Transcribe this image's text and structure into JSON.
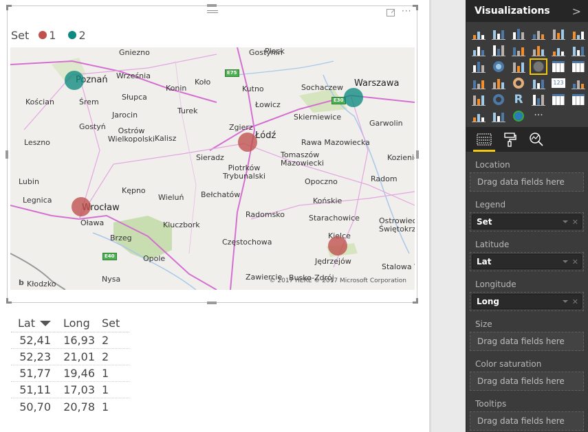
{
  "visual": {
    "legend": {
      "title": "Set",
      "items": [
        {
          "label": "1",
          "color": "#c0504d"
        },
        {
          "label": "2",
          "color": "#0d8a80"
        }
      ]
    },
    "more_label": "···",
    "map": {
      "copyright": "© 2017 HERE   © 2017 Microsoft Corporation",
      "bing_label": "b",
      "cities": [
        {
          "name": "Gniezno"
        },
        {
          "name": "Płock"
        },
        {
          "name": "Poznań"
        },
        {
          "name": "Września"
        },
        {
          "name": "Gostynin"
        },
        {
          "name": "Warszawa"
        },
        {
          "name": "Konin"
        },
        {
          "name": "Koło"
        },
        {
          "name": "Kutno"
        },
        {
          "name": "Sochaczew"
        },
        {
          "name": "Słupca"
        },
        {
          "name": "Kościan"
        },
        {
          "name": "Śrem"
        },
        {
          "name": "Łowicz"
        },
        {
          "name": "Turek"
        },
        {
          "name": "Jarocin"
        },
        {
          "name": "Skierniewice"
        },
        {
          "name": "Garwolin"
        },
        {
          "name": "Gostyń"
        },
        {
          "name": "Zgierz"
        },
        {
          "name": "Łódź"
        },
        {
          "name": "Kalisz"
        },
        {
          "name": "Leszno"
        },
        {
          "name": "Ostrów Wielkopolski"
        },
        {
          "name": "Rawa Mazowiecka"
        },
        {
          "name": "Sieradz"
        },
        {
          "name": "Tomaszów Mazowiecki"
        },
        {
          "name": "Kozienice"
        },
        {
          "name": "Piotrków Trybunalski"
        },
        {
          "name": "Lubin"
        },
        {
          "name": "Opoczno"
        },
        {
          "name": "Radom"
        },
        {
          "name": "Kępno"
        },
        {
          "name": "Legnica"
        },
        {
          "name": "Wieluń"
        },
        {
          "name": "Bełchatów"
        },
        {
          "name": "Końskie"
        },
        {
          "name": "Wrocław"
        },
        {
          "name": "Radomsko"
        },
        {
          "name": "Starachowice"
        },
        {
          "name": "Ostrowiec Świętokrzyski"
        },
        {
          "name": "Oława"
        },
        {
          "name": "Kluczbork"
        },
        {
          "name": "Brzeg"
        },
        {
          "name": "Kielce"
        },
        {
          "name": "Częstochowa"
        },
        {
          "name": "Opole"
        },
        {
          "name": "Jędrzejów"
        },
        {
          "name": "Stalowa Wola"
        },
        {
          "name": "Kłodzko"
        },
        {
          "name": "Nysa"
        },
        {
          "name": "Zawiercie"
        },
        {
          "name": "Busko-Zdrój"
        }
      ],
      "road_shields": [
        "E75",
        "E30",
        "E40"
      ]
    }
  },
  "table": {
    "headers": [
      "Lat",
      "Long",
      "Set"
    ],
    "sort_column": "Lat",
    "rows": [
      [
        "52,41",
        "16,93",
        "2"
      ],
      [
        "52,23",
        "21,01",
        "2"
      ],
      [
        "51,77",
        "19,46",
        "1"
      ],
      [
        "51,11",
        "17,03",
        "1"
      ],
      [
        "50,70",
        "20,78",
        "1"
      ]
    ]
  },
  "pane": {
    "title": "Visualizations",
    "collapse_icon": ">",
    "viz_icons": [
      "stacked-bar-chart",
      "stacked-column-chart",
      "clustered-bar-chart",
      "clustered-column-chart",
      "100-stacked-bar-chart",
      "100-stacked-column-chart",
      "line-chart",
      "area-chart",
      "stacked-area-chart",
      "line-clustered-column-chart",
      "line-stacked-column-chart",
      "ribbon-chart",
      "scatter-chart",
      "pie-chart",
      "treemap",
      "map",
      "table",
      "matrix",
      "filled-map",
      "funnel",
      "gauge",
      "multi-row-card",
      "card",
      "kpi",
      "slicer",
      "donut-chart",
      "r-script-visual",
      "shape-map",
      "table-visual",
      "matrix-visual",
      "waterfall",
      "color-tiles",
      "globe-map",
      "more-visuals"
    ],
    "selected_viz": "map",
    "more_label": "···",
    "tabs": [
      "fields-tab",
      "format-tab",
      "analytics-tab"
    ],
    "wells": [
      {
        "label": "Location",
        "placeholder": "Drag data fields here"
      },
      {
        "label": "Legend",
        "field": "Set"
      },
      {
        "label": "Latitude",
        "field": "Lat"
      },
      {
        "label": "Longitude",
        "field": "Long"
      },
      {
        "label": "Size",
        "placeholder": "Drag data fields here"
      },
      {
        "label": "Color saturation",
        "placeholder": "Drag data fields here"
      },
      {
        "label": "Tooltips",
        "placeholder": "Drag data fields here"
      }
    ]
  },
  "chart_data": {
    "type": "scatter",
    "title": "",
    "xlabel": "Long",
    "ylabel": "Lat",
    "legend_title": "Set",
    "legend_position": "top-left",
    "series": [
      {
        "name": "1",
        "color": "#c0504d",
        "points": [
          {
            "lat": 51.77,
            "long": 19.46
          },
          {
            "lat": 51.11,
            "long": 17.03
          },
          {
            "lat": 50.7,
            "long": 20.78
          }
        ]
      },
      {
        "name": "2",
        "color": "#0d8a80",
        "points": [
          {
            "lat": 52.41,
            "long": 16.93
          },
          {
            "lat": 52.23,
            "long": 21.01
          }
        ]
      }
    ]
  }
}
